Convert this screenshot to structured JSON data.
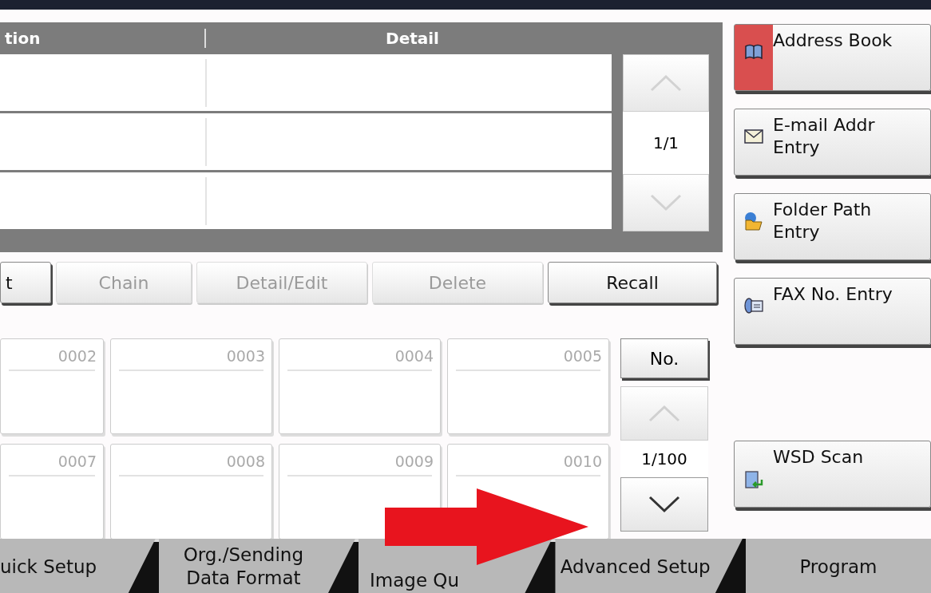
{
  "list": {
    "columns": [
      "tion",
      "Detail"
    ],
    "pager": {
      "page": "1/1",
      "up_disabled": true,
      "down_disabled": true
    }
  },
  "actions": [
    {
      "label": "t",
      "disabled": false
    },
    {
      "label": "Chain",
      "disabled": true
    },
    {
      "label": "Detail/Edit",
      "disabled": true
    },
    {
      "label": "Delete",
      "disabled": true
    },
    {
      "label": "Recall",
      "disabled": false
    }
  ],
  "keys": [
    [
      "0002",
      "0003",
      "0004",
      "0005"
    ],
    [
      "0007",
      "0008",
      "0009",
      "0010"
    ]
  ],
  "key_pager": {
    "mode": "No.",
    "page": "1/100",
    "up_disabled": true,
    "down_disabled": false
  },
  "side_buttons": [
    {
      "label": "Address Book",
      "selected": true
    },
    {
      "label": "E-mail Addr Entry",
      "selected": false
    },
    {
      "label": "Folder Path Entry",
      "selected": false
    },
    {
      "label": "FAX No. Entry",
      "selected": false
    },
    {
      "label": "WSD Scan",
      "selected": false
    }
  ],
  "tabs": [
    {
      "label": "uick Setup"
    },
    {
      "label": "Org./Sending Data Format"
    },
    {
      "label": "Image Qu"
    },
    {
      "label": "Advanced Setup"
    },
    {
      "label": "Program"
    }
  ]
}
